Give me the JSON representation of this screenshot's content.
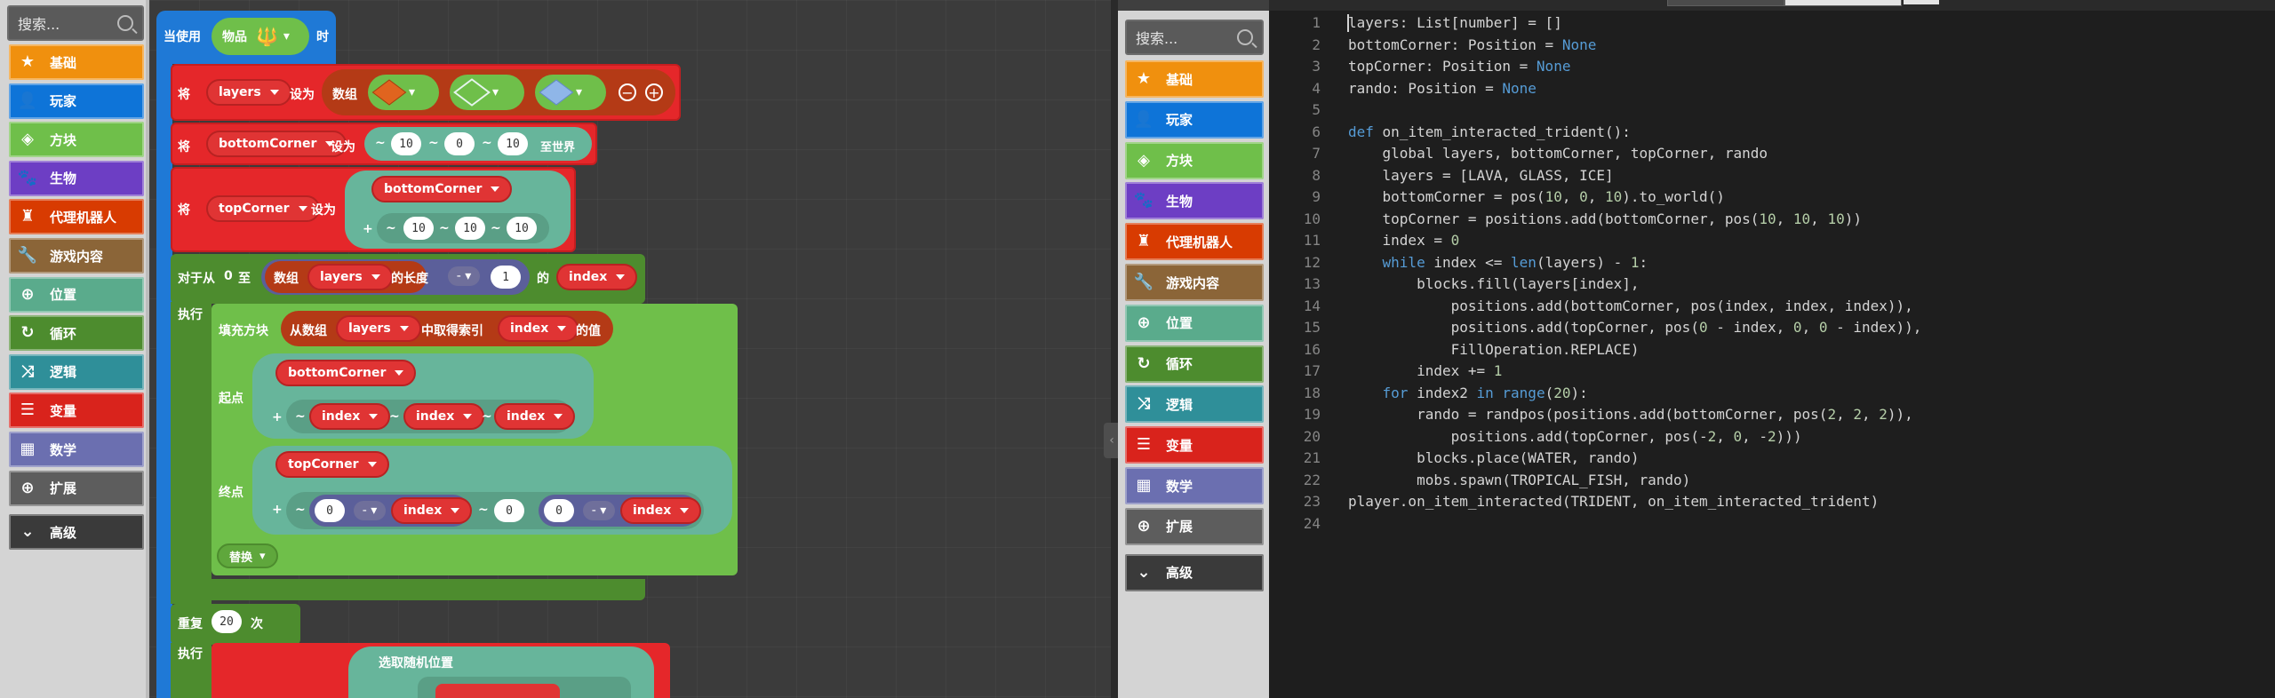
{
  "toolbox": {
    "search_placeholder": "搜索...",
    "categories": [
      {
        "label": "基础",
        "icon": "star-icon",
        "color": "#f0900e"
      },
      {
        "label": "玩家",
        "icon": "person-icon",
        "color": "#0e74d8"
      },
      {
        "label": "方块",
        "icon": "cube-icon",
        "color": "#6fbf4a"
      },
      {
        "label": "生物",
        "icon": "paw-icon",
        "color": "#6d3ec4"
      },
      {
        "label": "代理机器人",
        "icon": "robot-icon",
        "color": "#d83b01"
      },
      {
        "label": "游戏内容",
        "icon": "wrench-icon",
        "color": "#8b6538"
      },
      {
        "label": "位置",
        "icon": "crosshair-icon",
        "color": "#5aab8c"
      },
      {
        "label": "循环",
        "icon": "loop-icon",
        "color": "#4d8c2e"
      },
      {
        "label": "逻辑",
        "icon": "shuffle-icon",
        "color": "#2f8f99"
      },
      {
        "label": "变量",
        "icon": "list-icon",
        "color": "#d9231c"
      },
      {
        "label": "数学",
        "icon": "calculator-icon",
        "color": "#6b6fb0"
      },
      {
        "label": "扩展",
        "icon": "plus-circle-icon",
        "color": "#5d5d5d"
      },
      {
        "label": "高级",
        "icon": "chevron-down-icon",
        "color": "#3a3a3a"
      }
    ]
  },
  "blocks": {
    "event": {
      "when": "当使用",
      "item_label": "物品",
      "suffix": "时"
    },
    "set_layers": {
      "prefix": "将",
      "var": "layers",
      "set_to": "设为",
      "array_label": "数组"
    },
    "set_bottom": {
      "prefix": "将",
      "var": "bottomCorner",
      "set_to": "设为",
      "tilde": "~",
      "x": "10",
      "y": "0",
      "z": "10",
      "world": "至世界"
    },
    "set_top": {
      "prefix": "将",
      "var": "topCorner",
      "set_to": "设为",
      "ref": "bottomCorner",
      "plus": "+",
      "tilde": "~",
      "x": "10",
      "y": "10",
      "z": "10"
    },
    "for_loop": {
      "text1": "对于从",
      "from": "0",
      "text2": "至",
      "array_label": "数组",
      "arr_var": "layers",
      "length_label": "的长度",
      "minus": "-",
      "one": "1",
      "of_label": "的",
      "index_var": "index",
      "do": "执行"
    },
    "fill": {
      "label": "填充方块",
      "from_array": "从数组",
      "arr_var": "layers",
      "get_index": "中取得索引",
      "index_var": "index",
      "value_label": "的值",
      "from": "起点",
      "from_ref": "bottomCorner",
      "to": "终点",
      "to_ref": "topCorner",
      "plus": "+",
      "tilde": "~",
      "index_var2": "index",
      "zero": "0",
      "minus": "-",
      "replace": "替换"
    },
    "repeat": {
      "label": "重复",
      "count": "20",
      "times": "次",
      "do": "执行"
    },
    "random": {
      "label": "选取随机位置"
    }
  },
  "code": {
    "lines": [
      [
        {
          "t": "layers: List[number] = []"
        }
      ],
      [
        {
          "t": "bottomCorner: Position = "
        },
        {
          "t": "None",
          "c": "kw"
        }
      ],
      [
        {
          "t": "topCorner: Position = "
        },
        {
          "t": "None",
          "c": "kw"
        }
      ],
      [
        {
          "t": "rando: Position = "
        },
        {
          "t": "None",
          "c": "kw"
        }
      ],
      [
        {
          "t": ""
        }
      ],
      [
        {
          "t": "def",
          "c": "kw"
        },
        {
          "t": " on_item_interacted_trident():"
        }
      ],
      [
        {
          "t": "    global layers, bottomCorner, topCorner, rando"
        }
      ],
      [
        {
          "t": "    layers = [LAVA, GLASS, ICE]"
        }
      ],
      [
        {
          "t": "    bottomCorner = pos("
        },
        {
          "t": "10",
          "c": "nm"
        },
        {
          "t": ", "
        },
        {
          "t": "0",
          "c": "nm"
        },
        {
          "t": ", "
        },
        {
          "t": "10",
          "c": "nm"
        },
        {
          "t": ").to_world()"
        }
      ],
      [
        {
          "t": "    topCorner = positions.add(bottomCorner, pos("
        },
        {
          "t": "10",
          "c": "nm"
        },
        {
          "t": ", "
        },
        {
          "t": "10",
          "c": "nm"
        },
        {
          "t": ", "
        },
        {
          "t": "10",
          "c": "nm"
        },
        {
          "t": "))"
        }
      ],
      [
        {
          "t": "    index = "
        },
        {
          "t": "0",
          "c": "nm"
        }
      ],
      [
        {
          "t": "    "
        },
        {
          "t": "while",
          "c": "kw"
        },
        {
          "t": " index <= "
        },
        {
          "t": "len",
          "c": "kw"
        },
        {
          "t": "(layers) - "
        },
        {
          "t": "1",
          "c": "nm"
        },
        {
          "t": ":"
        }
      ],
      [
        {
          "t": "        blocks.fill(layers[index],"
        }
      ],
      [
        {
          "t": "            positions.add(bottomCorner, pos(index, index, index)),"
        }
      ],
      [
        {
          "t": "            positions.add(topCorner, pos("
        },
        {
          "t": "0",
          "c": "nm"
        },
        {
          "t": " - index, "
        },
        {
          "t": "0",
          "c": "nm"
        },
        {
          "t": ", "
        },
        {
          "t": "0",
          "c": "nm"
        },
        {
          "t": " - index)),"
        }
      ],
      [
        {
          "t": "            FillOperation.REPLACE)"
        }
      ],
      [
        {
          "t": "        index += "
        },
        {
          "t": "1",
          "c": "nm"
        }
      ],
      [
        {
          "t": "    "
        },
        {
          "t": "for",
          "c": "kw"
        },
        {
          "t": " index2 "
        },
        {
          "t": "in",
          "c": "kw"
        },
        {
          "t": " "
        },
        {
          "t": "range",
          "c": "kw"
        },
        {
          "t": "("
        },
        {
          "t": "20",
          "c": "nm"
        },
        {
          "t": "):"
        }
      ],
      [
        {
          "t": "        rando = randpos(positions.add(bottomCorner, pos("
        },
        {
          "t": "2",
          "c": "nm"
        },
        {
          "t": ", "
        },
        {
          "t": "2",
          "c": "nm"
        },
        {
          "t": ", "
        },
        {
          "t": "2",
          "c": "nm"
        },
        {
          "t": ")),"
        }
      ],
      [
        {
          "t": "            positions.add(topCorner, pos(-"
        },
        {
          "t": "2",
          "c": "nm"
        },
        {
          "t": ", "
        },
        {
          "t": "0",
          "c": "nm"
        },
        {
          "t": ", -"
        },
        {
          "t": "2",
          "c": "nm"
        },
        {
          "t": ")))"
        }
      ],
      [
        {
          "t": "        blocks.place(WATER, rando)"
        }
      ],
      [
        {
          "t": "        mobs.spawn(TROPICAL_FISH, rando)"
        }
      ],
      [
        {
          "t": "player.on_item_interacted(TRIDENT, on_item_interacted_trident)"
        }
      ],
      [
        {
          "t": ""
        }
      ]
    ]
  }
}
